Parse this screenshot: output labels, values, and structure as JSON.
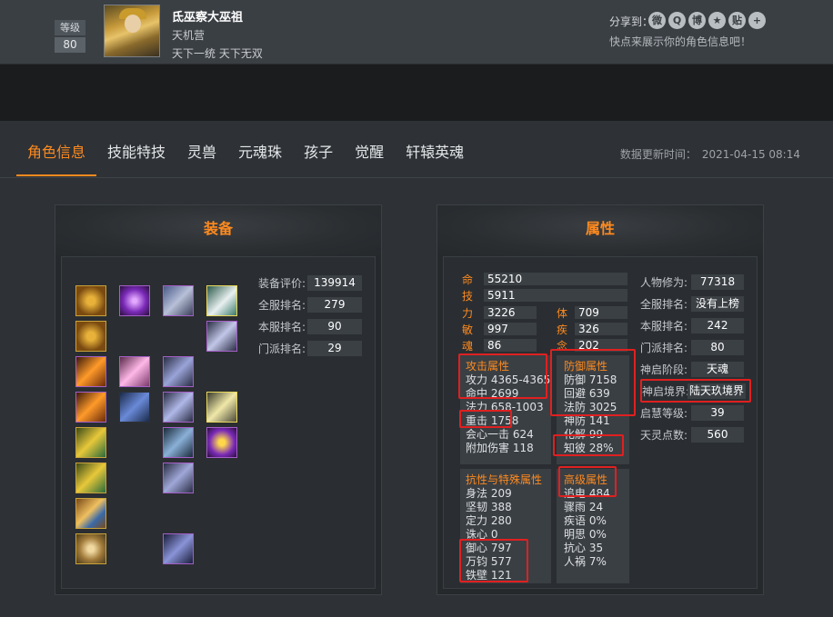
{
  "header": {
    "level_label": "等级",
    "level_value": "80",
    "name": "氐巫察大巫祖",
    "guild": "天机营",
    "motto": "天下一统 天下无双",
    "share_label": "分享到：",
    "share_hint": "快点来展示你的角色信息吧！",
    "share_icons": [
      "wechat-icon",
      "qq-icon",
      "weibo-icon",
      "qzone-icon",
      "tieba-icon",
      "more-icon"
    ]
  },
  "tabs": [
    "角色信息",
    "技能特技",
    "灵兽",
    "元魂珠",
    "孩子",
    "觉醒",
    "轩辕英魂"
  ],
  "update_label": "数据更新时间：",
  "update_time": "2021-04-15 08:14",
  "equip": {
    "title": "装备",
    "stats": [
      {
        "label": "装备评价:",
        "value": "139914"
      },
      {
        "label": "全服排名:",
        "value": "279"
      },
      {
        "label": "本服排名:",
        "value": "90"
      },
      {
        "label": "门派排名:",
        "value": "29"
      }
    ]
  },
  "attr": {
    "title": "属性",
    "bars": [
      {
        "label": "命",
        "value": "55210"
      },
      {
        "label": "技",
        "value": "5911"
      }
    ],
    "base": [
      {
        "label": "力",
        "value": "3226"
      },
      {
        "label": "体",
        "value": "709"
      },
      {
        "label": "敏",
        "value": "997"
      },
      {
        "label": "疾",
        "value": "326"
      },
      {
        "label": "魂",
        "value": "86"
      },
      {
        "label": "念",
        "value": "202"
      }
    ],
    "side": [
      {
        "label": "人物修为:",
        "value": "77318"
      },
      {
        "label": "全服排名:",
        "value": "没有上榜"
      },
      {
        "label": "本服排名:",
        "value": "242"
      },
      {
        "label": "门派排名:",
        "value": "80"
      },
      {
        "label": "神启阶段:",
        "value": "天魂"
      },
      {
        "label": "神启境界:",
        "value": "陆天玖境界"
      },
      {
        "label": "启慧等级:",
        "value": "39"
      },
      {
        "label": "天灵点数:",
        "value": "560"
      }
    ],
    "attack": {
      "title": "攻击属性",
      "lines": [
        "攻力 4365-4365",
        "命中 2699",
        "法力 658-1003",
        "重击 1758",
        "会心一击 624",
        "附加伤害 118"
      ]
    },
    "defense": {
      "title": "防御属性",
      "lines": [
        "防御 7158",
        "回避 639",
        "法防 3025",
        "神防 141",
        "化解 99",
        "知彼 28%"
      ]
    },
    "resist": {
      "title": "抗性与特殊属性",
      "lines": [
        "身法 209",
        "坚韧 388",
        "定力 280",
        "诛心 0",
        "御心 797",
        "万钧 577",
        "铁壁 121"
      ]
    },
    "advanced": {
      "title": "高级属性",
      "lines": [
        "追电 484",
        "骤雨 24",
        "疾语 0%",
        "明思 0%",
        "抗心 35",
        "人祸 7%"
      ]
    }
  }
}
